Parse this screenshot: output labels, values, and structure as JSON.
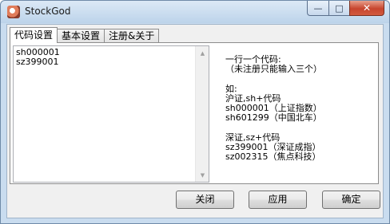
{
  "window": {
    "title": "StockGod",
    "icon": "stock-app-icon",
    "controls": {
      "minimize": "—",
      "maximize": "□",
      "close": "✕"
    }
  },
  "tabs": [
    {
      "label": "代码设置",
      "active": true
    },
    {
      "label": "基本设置",
      "active": false
    },
    {
      "label": "注册&关于",
      "active": false
    }
  ],
  "code_settings": {
    "codes_value": "sh000001\nsz399001",
    "help_lines": [
      "一行一个代码:",
      "（未注册只能输入三个）",
      "",
      "如:",
      "沪证,sh+代码",
      "sh000001（上证指数）",
      "sh601299（中国北车）",
      "",
      "深证,sz+代码",
      "sz399001（深证成指）",
      "sz002315（焦点科技）"
    ]
  },
  "buttons": {
    "close_label": "关闭",
    "apply_label": "应用",
    "ok_label": "确定"
  },
  "colors": {
    "titlebar": "#c9dcef",
    "close_button": "#c7452e"
  }
}
